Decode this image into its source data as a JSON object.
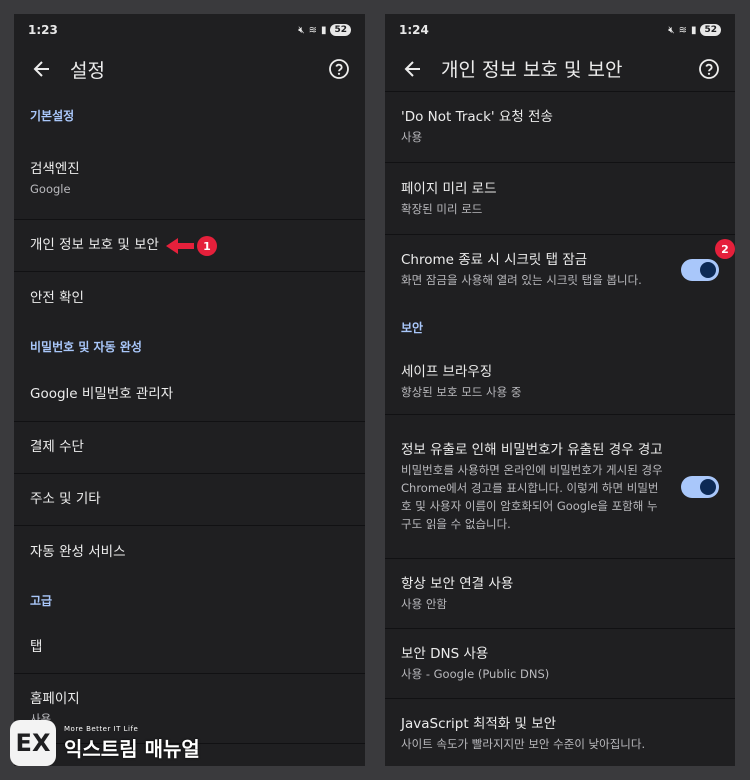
{
  "left": {
    "status": {
      "time": "1:23",
      "battery": "52"
    },
    "title": "설정",
    "section_basic": "기본설정",
    "search_engine": {
      "title": "검색엔진",
      "sub": "Google"
    },
    "privacy": "개인 정보 보호 및 보안",
    "safety_check": "안전 확인",
    "section_autofill": "비밀번호 및 자동 완성",
    "password_manager": "Google 비밀번호 관리자",
    "payment": "결제 수단",
    "address": "주소 및 기타",
    "autofill_services": "자동 완성 서비스",
    "section_advanced": "고급",
    "tabs": "탭",
    "homepage": {
      "title": "홈페이지",
      "sub": "사용"
    },
    "badge": "1"
  },
  "right": {
    "status": {
      "time": "1:24",
      "battery": "52"
    },
    "title": "개인 정보 보호 및 보안",
    "do_not_track": {
      "title": "'Do Not Track' 요청 전송",
      "sub": "사용"
    },
    "preload": {
      "title": "페이지 미리 로드",
      "sub": "확장된 미리 로드"
    },
    "incognito_lock": {
      "title": "Chrome 종료 시 시크릿 탭 잠금",
      "sub": "화면 잠금을 사용해 열려 있는 시크릿 탭을 봅니다.",
      "checked": true
    },
    "section_security": "보안",
    "safe_browsing": {
      "title": "세이프 브라우징",
      "sub": "향상된 보호 모드 사용 중"
    },
    "leak_warning": {
      "title": "정보 유출로 인해 비밀번호가 유출된 경우 경고",
      "sub": "비밀번호를 사용하면 온라인에 비밀번호가 게시된 경우 Chrome에서 경고를 표시합니다. 이렇게 하면 비밀번호 및 사용자 이름이 암호화되어 Google을 포함해 누구도 읽을 수 없습니다.",
      "checked": true
    },
    "secure_connection": {
      "title": "항상 보안 연결 사용",
      "sub": "사용 안함"
    },
    "secure_dns": {
      "title": "보안 DNS 사용",
      "sub": "사용 - Google (Public DNS)"
    },
    "js_optimization": {
      "title": "JavaScript 최적화 및 보안",
      "sub": "사이트 속도가 빨라지지만 보안 수준이 낮아집니다."
    },
    "badge": "2"
  },
  "watermark": {
    "logo_letter": "EX",
    "tagline": "More Better IT Life",
    "name": "익스트림 매뉴얼"
  },
  "colors": {
    "accent": "#a9c7fa",
    "badge": "#e5203b",
    "background": "#1f1f21"
  }
}
